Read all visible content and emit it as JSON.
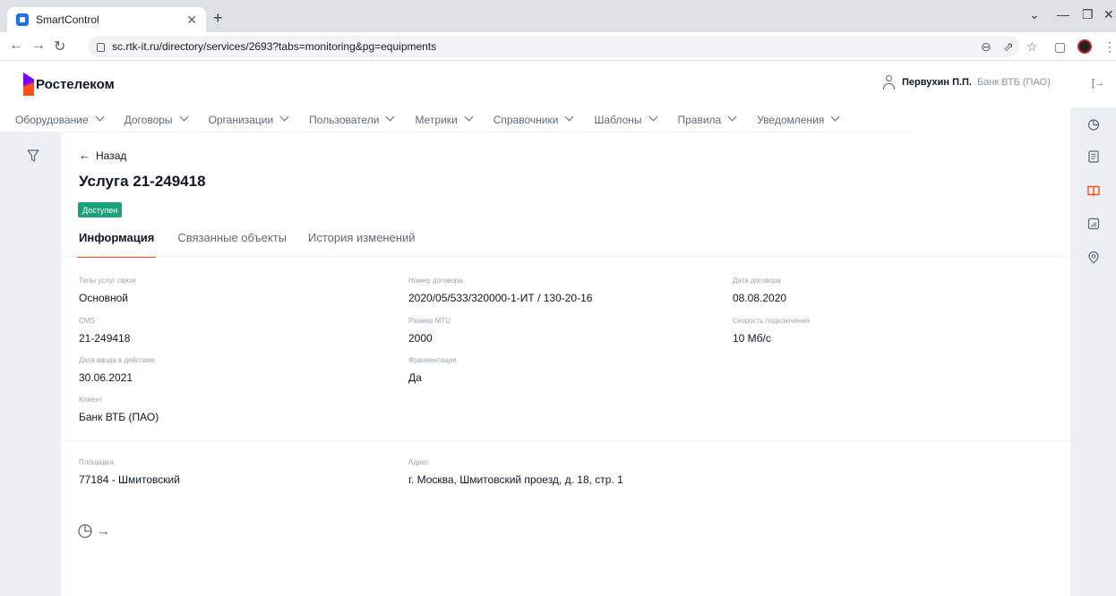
{
  "browser": {
    "tab_title": "SmartControl",
    "url": "sc.rtk-it.ru/directory/services/2693?tabs=monitoring&pg=equipments"
  },
  "header": {
    "logo_text": "Ростелеком",
    "user_name": "Первухин П.П.",
    "user_org": "Банк ВТБ (ПАО)"
  },
  "menu": [
    "Оборудование",
    "Договоры",
    "Организации",
    "Пользователи",
    "Метрики",
    "Справочники",
    "Шаблоны",
    "Правила",
    "Уведомления"
  ],
  "page": {
    "back_label": "Назад",
    "title": "Услуга 21-249418",
    "status": "Доступен",
    "status_color": "#1aa37a",
    "tabs": [
      "Информация",
      "Связанные объекты",
      "История изменений"
    ]
  },
  "fields": {
    "service_type": {
      "label": "Типы услуг связи",
      "value": "Основной"
    },
    "contract_number": {
      "label": "Номер договора",
      "value": "2020/05/533/320000-1-ИТ / 130-20-16"
    },
    "contract_date": {
      "label": "Дата договора",
      "value": "08.08.2020"
    },
    "cms": {
      "label": "CMS",
      "value": "21-249418"
    },
    "mtu": {
      "label": "Размер MTU",
      "value": "2000"
    },
    "speed": {
      "label": "Скорость подключения",
      "value": "10 Мб/с"
    },
    "start_date": {
      "label": "Дата ввода в действие",
      "value": "30.06.2021"
    },
    "fragmentation": {
      "label": "Фрагментация",
      "value": "Да"
    },
    "client": {
      "label": "Клиент",
      "value": "Банк ВТБ (ПАО)"
    },
    "site": {
      "label": "Площадка",
      "value": "77184 - Шмитовский"
    },
    "address": {
      "label": "Адрес",
      "value": "г. Москва, Шмитовский проезд, д. 18, стр. 1"
    }
  },
  "accent_color": "#ff4f12"
}
